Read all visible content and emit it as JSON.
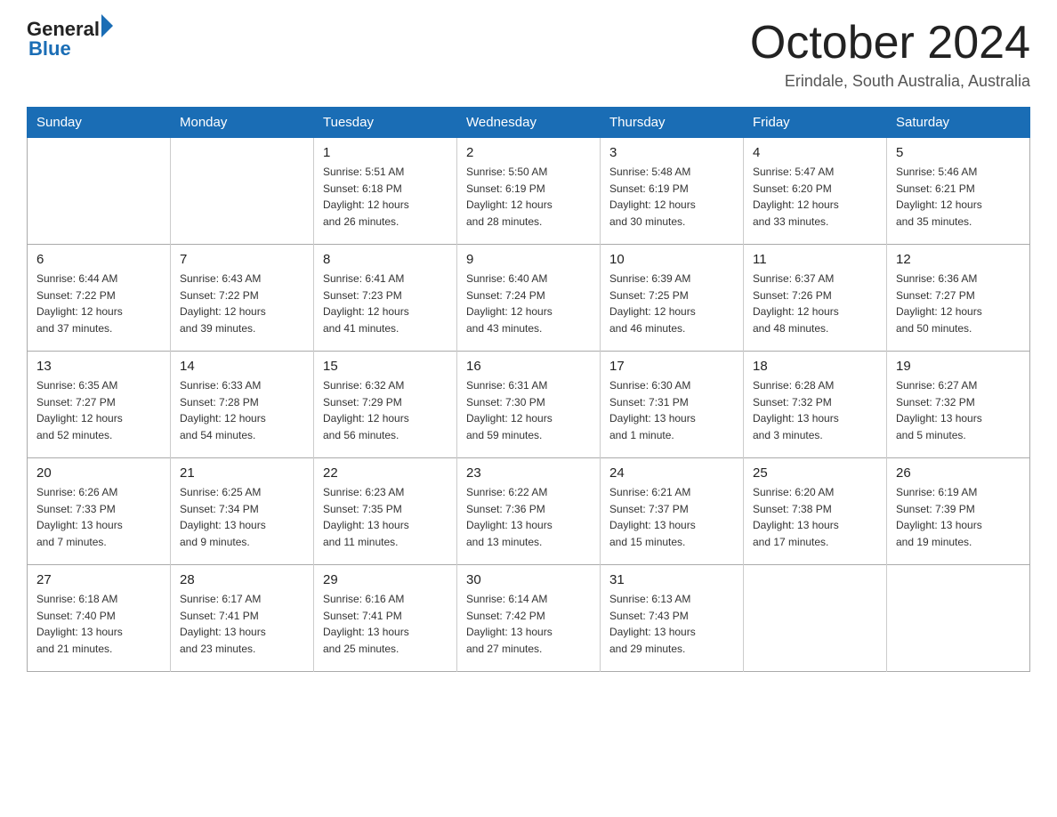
{
  "logo": {
    "general": "General",
    "blue": "Blue"
  },
  "header": {
    "month": "October 2024",
    "location": "Erindale, South Australia, Australia"
  },
  "weekdays": [
    "Sunday",
    "Monday",
    "Tuesday",
    "Wednesday",
    "Thursday",
    "Friday",
    "Saturday"
  ],
  "weeks": [
    [
      {
        "day": "",
        "info": ""
      },
      {
        "day": "",
        "info": ""
      },
      {
        "day": "1",
        "info": "Sunrise: 5:51 AM\nSunset: 6:18 PM\nDaylight: 12 hours\nand 26 minutes."
      },
      {
        "day": "2",
        "info": "Sunrise: 5:50 AM\nSunset: 6:19 PM\nDaylight: 12 hours\nand 28 minutes."
      },
      {
        "day": "3",
        "info": "Sunrise: 5:48 AM\nSunset: 6:19 PM\nDaylight: 12 hours\nand 30 minutes."
      },
      {
        "day": "4",
        "info": "Sunrise: 5:47 AM\nSunset: 6:20 PM\nDaylight: 12 hours\nand 33 minutes."
      },
      {
        "day": "5",
        "info": "Sunrise: 5:46 AM\nSunset: 6:21 PM\nDaylight: 12 hours\nand 35 minutes."
      }
    ],
    [
      {
        "day": "6",
        "info": "Sunrise: 6:44 AM\nSunset: 7:22 PM\nDaylight: 12 hours\nand 37 minutes."
      },
      {
        "day": "7",
        "info": "Sunrise: 6:43 AM\nSunset: 7:22 PM\nDaylight: 12 hours\nand 39 minutes."
      },
      {
        "day": "8",
        "info": "Sunrise: 6:41 AM\nSunset: 7:23 PM\nDaylight: 12 hours\nand 41 minutes."
      },
      {
        "day": "9",
        "info": "Sunrise: 6:40 AM\nSunset: 7:24 PM\nDaylight: 12 hours\nand 43 minutes."
      },
      {
        "day": "10",
        "info": "Sunrise: 6:39 AM\nSunset: 7:25 PM\nDaylight: 12 hours\nand 46 minutes."
      },
      {
        "day": "11",
        "info": "Sunrise: 6:37 AM\nSunset: 7:26 PM\nDaylight: 12 hours\nand 48 minutes."
      },
      {
        "day": "12",
        "info": "Sunrise: 6:36 AM\nSunset: 7:27 PM\nDaylight: 12 hours\nand 50 minutes."
      }
    ],
    [
      {
        "day": "13",
        "info": "Sunrise: 6:35 AM\nSunset: 7:27 PM\nDaylight: 12 hours\nand 52 minutes."
      },
      {
        "day": "14",
        "info": "Sunrise: 6:33 AM\nSunset: 7:28 PM\nDaylight: 12 hours\nand 54 minutes."
      },
      {
        "day": "15",
        "info": "Sunrise: 6:32 AM\nSunset: 7:29 PM\nDaylight: 12 hours\nand 56 minutes."
      },
      {
        "day": "16",
        "info": "Sunrise: 6:31 AM\nSunset: 7:30 PM\nDaylight: 12 hours\nand 59 minutes."
      },
      {
        "day": "17",
        "info": "Sunrise: 6:30 AM\nSunset: 7:31 PM\nDaylight: 13 hours\nand 1 minute."
      },
      {
        "day": "18",
        "info": "Sunrise: 6:28 AM\nSunset: 7:32 PM\nDaylight: 13 hours\nand 3 minutes."
      },
      {
        "day": "19",
        "info": "Sunrise: 6:27 AM\nSunset: 7:32 PM\nDaylight: 13 hours\nand 5 minutes."
      }
    ],
    [
      {
        "day": "20",
        "info": "Sunrise: 6:26 AM\nSunset: 7:33 PM\nDaylight: 13 hours\nand 7 minutes."
      },
      {
        "day": "21",
        "info": "Sunrise: 6:25 AM\nSunset: 7:34 PM\nDaylight: 13 hours\nand 9 minutes."
      },
      {
        "day": "22",
        "info": "Sunrise: 6:23 AM\nSunset: 7:35 PM\nDaylight: 13 hours\nand 11 minutes."
      },
      {
        "day": "23",
        "info": "Sunrise: 6:22 AM\nSunset: 7:36 PM\nDaylight: 13 hours\nand 13 minutes."
      },
      {
        "day": "24",
        "info": "Sunrise: 6:21 AM\nSunset: 7:37 PM\nDaylight: 13 hours\nand 15 minutes."
      },
      {
        "day": "25",
        "info": "Sunrise: 6:20 AM\nSunset: 7:38 PM\nDaylight: 13 hours\nand 17 minutes."
      },
      {
        "day": "26",
        "info": "Sunrise: 6:19 AM\nSunset: 7:39 PM\nDaylight: 13 hours\nand 19 minutes."
      }
    ],
    [
      {
        "day": "27",
        "info": "Sunrise: 6:18 AM\nSunset: 7:40 PM\nDaylight: 13 hours\nand 21 minutes."
      },
      {
        "day": "28",
        "info": "Sunrise: 6:17 AM\nSunset: 7:41 PM\nDaylight: 13 hours\nand 23 minutes."
      },
      {
        "day": "29",
        "info": "Sunrise: 6:16 AM\nSunset: 7:41 PM\nDaylight: 13 hours\nand 25 minutes."
      },
      {
        "day": "30",
        "info": "Sunrise: 6:14 AM\nSunset: 7:42 PM\nDaylight: 13 hours\nand 27 minutes."
      },
      {
        "day": "31",
        "info": "Sunrise: 6:13 AM\nSunset: 7:43 PM\nDaylight: 13 hours\nand 29 minutes."
      },
      {
        "day": "",
        "info": ""
      },
      {
        "day": "",
        "info": ""
      }
    ]
  ]
}
